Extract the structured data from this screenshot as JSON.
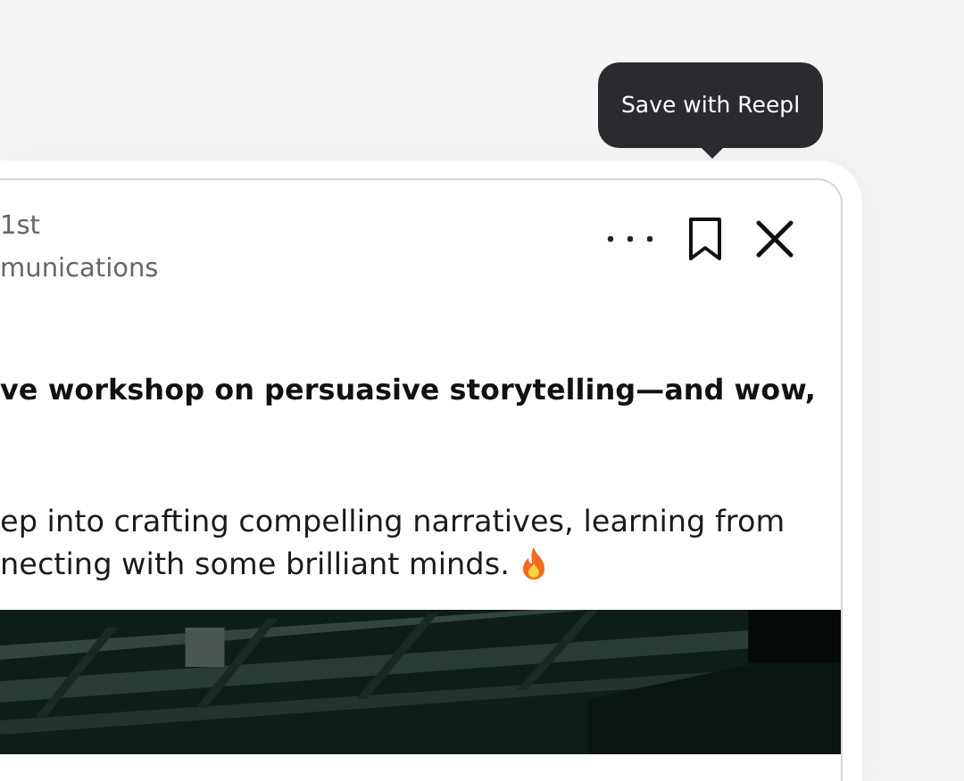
{
  "tooltip": {
    "text": "Save with Reepl"
  },
  "author": {
    "connection": "1st",
    "headline": "munications"
  },
  "post": {
    "lead": "ve workshop on persuasive storytelling—and wow,",
    "body": [
      "ep into crafting compelling narratives, learning from",
      "necting with some brilliant minds."
    ]
  }
}
